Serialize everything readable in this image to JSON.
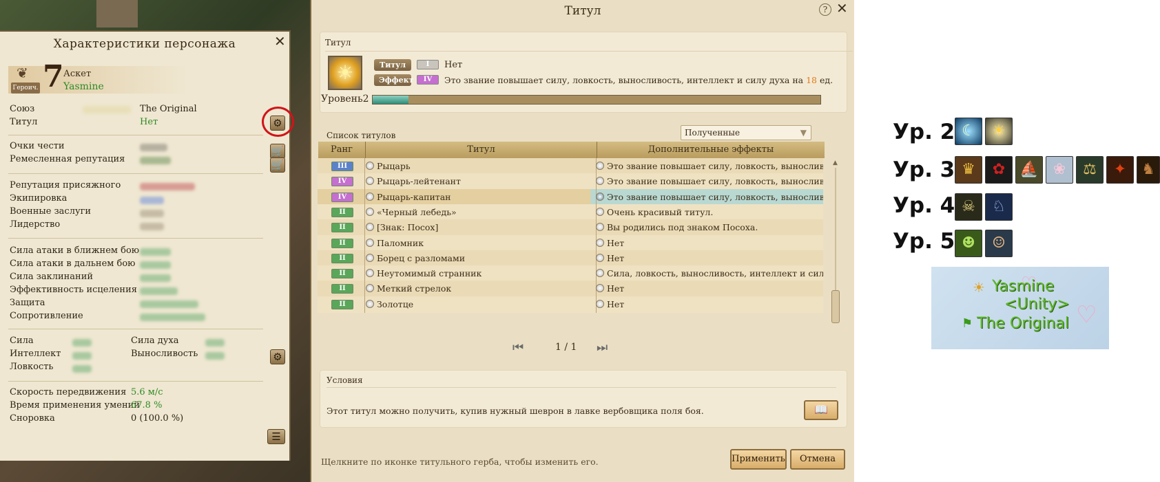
{
  "character_panel": {
    "title": "Характеристики персонажа",
    "level": "7",
    "class": "Аскет",
    "name": "Yasmine",
    "badge": "Героич.",
    "union_label": "Союз",
    "union_value": "The Original",
    "title_label": "Титул",
    "title_value": "Нет",
    "group1": [
      "Очки чести",
      "Ремесленная репутация"
    ],
    "group2": [
      "Репутация присяжного",
      "Экипировка",
      "Военные заслуги",
      "Лидерство"
    ],
    "group3": [
      "Сила атаки в ближнем бою",
      "Сила атаки в дальнем бою",
      "Сила заклинаний",
      "Эффективность исцеления",
      "Защита",
      "Сопротивление"
    ],
    "attrs_left": [
      "Сила",
      "Интеллект",
      "Ловкость"
    ],
    "attrs_right": [
      "Сила духа",
      "Выносливость"
    ],
    "speed_rows": [
      {
        "label": "Скорость передвижения",
        "value": "5.6 м/с"
      },
      {
        "label": "Время применения умений",
        "value": "67.8 %"
      },
      {
        "label": "Сноровка",
        "value": "0 (100.0 %)"
      }
    ]
  },
  "title_window": {
    "title": "Титул",
    "help": "?",
    "section_label": "Титул",
    "tag_title": "Титул",
    "tag_effect": "Эффект",
    "current_rank": "I",
    "current_title": "Нет",
    "effect_rank": "IV",
    "effect_text_a": "Это звание повышает силу, ловкость, выносливость, интеллект и силу духа на",
    "effect_number": "18",
    "effect_text_b": "ед.",
    "level_label": "Уровень2",
    "level_progress": 0.08,
    "list_label": "Список титулов",
    "filter_value": "Полученные",
    "columns": [
      "Ранг",
      "Титул",
      "Дополнительные эффекты"
    ],
    "rows": [
      {
        "rank": "III",
        "color": "#5b82c9",
        "title": "Рыцарь",
        "effect": "Это звание повышает силу, ловкость, выносливость,..."
      },
      {
        "rank": "IV",
        "color": "#c56fd0",
        "title": "Рыцарь-лейтенант",
        "effect": "Это звание повышает силу, ловкость, выносливость,..."
      },
      {
        "rank": "IV",
        "color": "#c56fd0",
        "title": "Рыцарь-капитан",
        "effect": "Это звание повышает силу, ловкость, выносливость,..."
      },
      {
        "rank": "II",
        "color": "#5aa65a",
        "title": "«Черный лебедь»",
        "effect": "Очень красивый титул."
      },
      {
        "rank": "II",
        "color": "#5aa65a",
        "title": "[Знак: Посох]",
        "effect": "Вы родились под знаком Посоха."
      },
      {
        "rank": "II",
        "color": "#5aa65a",
        "title": "Паломник",
        "effect": "Нет"
      },
      {
        "rank": "II",
        "color": "#5aa65a",
        "title": "Борец с разломами",
        "effect": "Нет"
      },
      {
        "rank": "II",
        "color": "#5aa65a",
        "title": "Неутомимый странник",
        "effect": "Сила, ловкость, выносливость, интеллект и сила дух..."
      },
      {
        "rank": "II",
        "color": "#5aa65a",
        "title": "Меткий стрелок",
        "effect": "Нет"
      },
      {
        "rank": "II",
        "color": "#5aa65a",
        "title": "Золотце",
        "effect": "Нет"
      }
    ],
    "pagination": "1 / 1",
    "conditions_label": "Условия",
    "conditions_text": "Этот титул можно получить, купив нужный шеврон в лавке вербовщика поля боя.",
    "footer_hint": "Щелкните по иконке титульного герба, чтобы изменить его.",
    "apply_label": "Применить",
    "cancel_label": "Отмена"
  },
  "legend": {
    "levels": [
      "Ур. 2",
      "Ур. 3",
      "Ур. 4",
      "Ур. 5"
    ],
    "preview_name": "Yasmine",
    "preview_guild": "<Unity>",
    "preview_union": "The Original"
  }
}
